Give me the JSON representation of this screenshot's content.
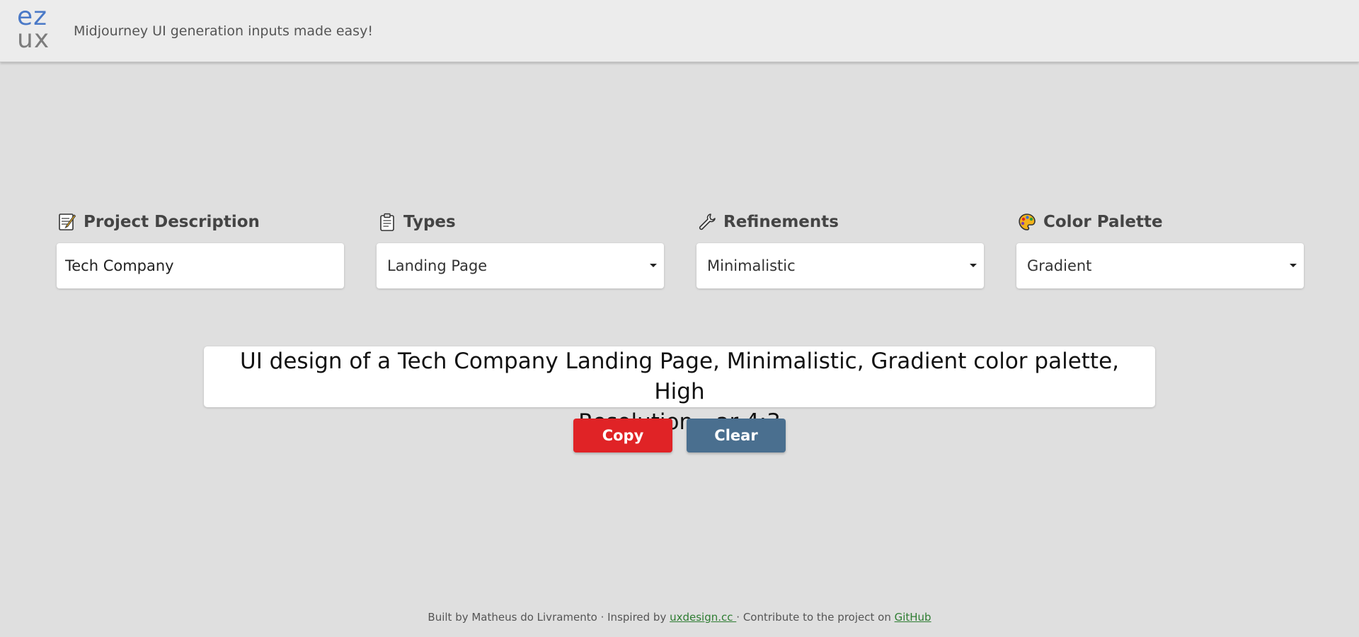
{
  "header": {
    "logo_top": "ez",
    "logo_bottom": "ux",
    "tagline": "Midjourney UI generation inputs made easy!"
  },
  "fields": {
    "project": {
      "label": "Project Description",
      "value": "Tech Company",
      "icon": "memo-icon"
    },
    "types": {
      "label": "Types",
      "value": "Landing Page",
      "icon": "clipboard-icon"
    },
    "refinements": {
      "label": "Refinements",
      "value": "Minimalistic",
      "icon": "wrench-icon"
    },
    "palette": {
      "label": "Color Palette",
      "value": "Gradient",
      "icon": "palette-icon"
    }
  },
  "output": {
    "line1": "UI design of a Tech Company Landing Page, Minimalistic, Gradient color palette, High",
    "line2": "Resolution --ar 4:3"
  },
  "buttons": {
    "copy": "Copy",
    "clear": "Clear"
  },
  "footer": {
    "prefix": "Built by Matheus do Livramento · Inspired by ",
    "link1": "uxdesign.cc ",
    "middle": "· Contribute to the project on ",
    "link2": "GitHub"
  },
  "colors": {
    "background": "#dfdfdf",
    "header": "#ececec",
    "copy_button": "#e02326",
    "clear_button": "#4a6f8f",
    "logo_blue": "#4a79c7",
    "link_green": "#2e7d32"
  }
}
